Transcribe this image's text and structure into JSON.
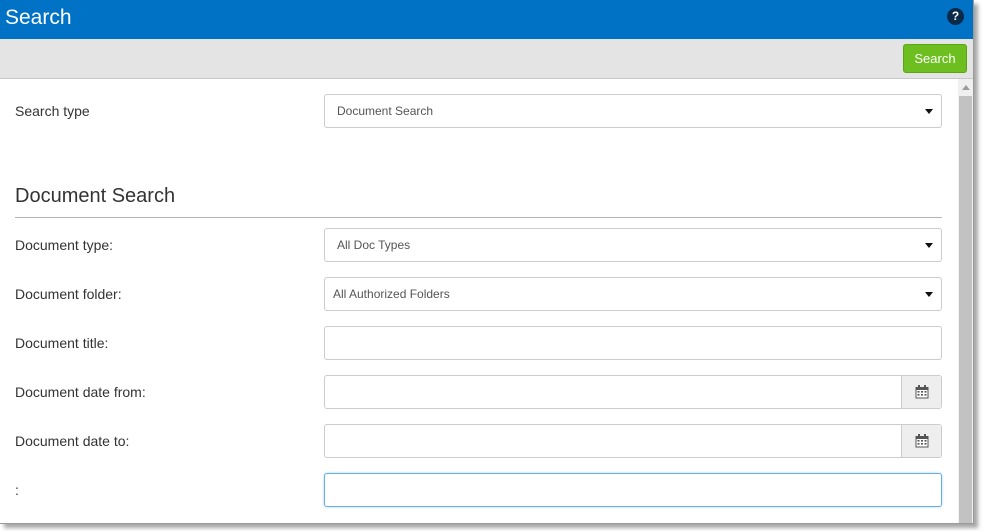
{
  "window": {
    "title": "Search"
  },
  "header": {
    "help_icon": "question-circle-icon",
    "help_glyph": "?"
  },
  "toolbar": {
    "search_button": "Search",
    "accent_color": "#6cbf1f"
  },
  "search_type": {
    "label": "Search type",
    "value": "Document Search"
  },
  "section": {
    "title": "Document Search"
  },
  "fields": {
    "doc_type": {
      "label": "Document type:",
      "value": "All Doc Types"
    },
    "doc_folder": {
      "label": "Document folder:",
      "value": "All Authorized Folders"
    },
    "doc_title": {
      "label": "Document title:",
      "value": ""
    },
    "date_from": {
      "label": "Document date from:",
      "value": "",
      "icon": "calendar-icon"
    },
    "date_to": {
      "label": "Document date to:",
      "value": "",
      "icon": "calendar-icon"
    },
    "extra": {
      "label": ":",
      "value": ""
    }
  },
  "colors": {
    "titlebar": "#0072c6",
    "toolbar": "#e4e4e4"
  }
}
